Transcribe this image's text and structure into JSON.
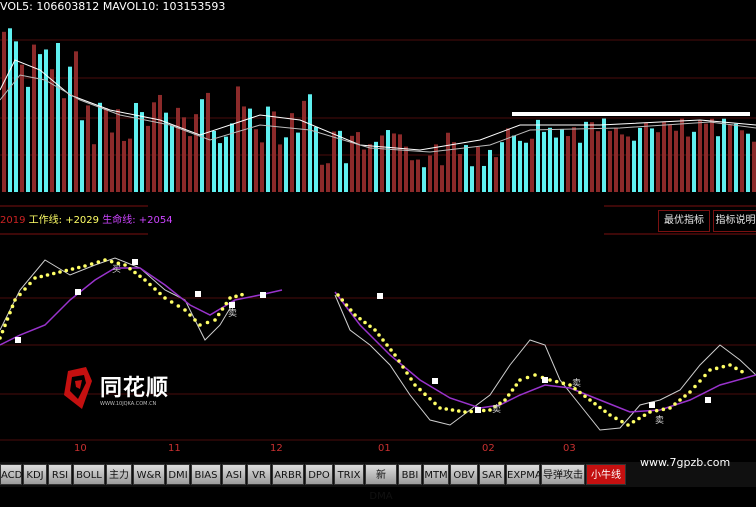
{
  "volume_panel": {
    "legend_vol5": "VOL5: 106603812",
    "legend_mavol10": "MAVOL10: 103153593"
  },
  "indicator_panel": {
    "year_label": "2019",
    "work_line": "工作线: +2029",
    "life_line": "生命线: +2054",
    "btn_optimize": "最优指标",
    "btn_explain": "指标说明",
    "marker_labels": [
      "买",
      "卖",
      "卖",
      "卖",
      "卖"
    ]
  },
  "x_axis": {
    "labels": [
      "10",
      "11",
      "12",
      "01",
      "02",
      "03"
    ]
  },
  "tabs": [
    "ACD",
    "KDJ",
    "RSI",
    "BOLL",
    "主力",
    "W&R",
    "DMI",
    "BIAS",
    "ASI",
    "VR",
    "ARBR",
    "DPO",
    "TRIX",
    "新DMA",
    "BBI",
    "MTM",
    "OBV",
    "SAR",
    "EXPMA",
    "导弹攻击",
    "小牛线"
  ],
  "active_tab": "小牛线",
  "logo": {
    "name": "同花顺",
    "url": "WWW.10JQKA.COM.CN"
  },
  "watermark": "www.7gpzb.com",
  "colors": {
    "up_bar": "#8c2a2a",
    "down_bar": "#5ff0f0",
    "work_line": "#ffff66",
    "life_line": "#9933cc",
    "accent_red": "#c41010"
  }
}
